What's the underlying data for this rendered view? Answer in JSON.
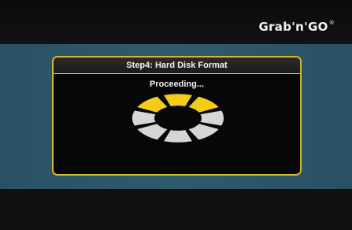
{
  "header": {
    "logo_text": "Grab'n'GO",
    "logo_mark": "®"
  },
  "dialog": {
    "title": "Step4: Hard Disk Format",
    "status": "Proceeding...",
    "spinner": {
      "icon": "progress-ring-icon",
      "segments_total": 8,
      "segments_highlighted": 3,
      "active_color": "#f3cc1a",
      "inactive_color": "#d6d6d6"
    }
  },
  "colors": {
    "background": "#060606",
    "band": "#2f5a6e",
    "dialog_border": "#d8b33a",
    "dialog_bg": "#070707"
  }
}
